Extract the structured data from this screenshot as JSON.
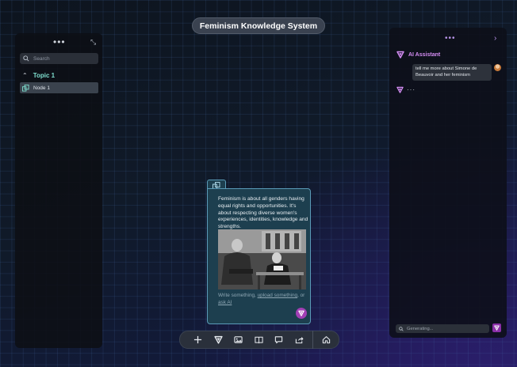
{
  "app": {
    "title": "Feminism Knowledge System"
  },
  "sidebar": {
    "menu_icon": "more-horizontal-icon",
    "collapse_icon": "collapse-arrow-icon",
    "search": {
      "placeholder": "Search",
      "value": ""
    },
    "topics": [
      {
        "label": "Topic 1",
        "expanded": true,
        "nodes": [
          {
            "label": "Node 1",
            "selected": true
          }
        ]
      }
    ]
  },
  "assistant": {
    "title": "AI Assistant",
    "menu_icon": "more-horizontal-icon",
    "close_icon": "chevron-right-icon",
    "messages": [
      {
        "role": "user",
        "text": "tell me more about Simone de Beauvoir and her feminism"
      },
      {
        "role": "assistant",
        "text": "···"
      }
    ],
    "input": {
      "placeholder": "Generating...",
      "value": ""
    }
  },
  "card": {
    "text": "Feminism is about all genders having equal rights and opportunities. It's about respecting diverse women's experiences, identities, knowledge and strengths.",
    "image_alt_icon": "photo-icon",
    "hint": {
      "prefix": "Write something, ",
      "upload_link": "upload something",
      "middle": ", or ",
      "ask_link": "ask AI"
    }
  },
  "toolbar": {
    "buttons": [
      {
        "name": "add-button",
        "icon": "plus-icon"
      },
      {
        "name": "ai-button",
        "icon": "ai-logo-icon"
      },
      {
        "name": "image-button",
        "icon": "image-icon"
      },
      {
        "name": "book-button",
        "icon": "book-icon"
      },
      {
        "name": "comment-button",
        "icon": "comment-icon"
      },
      {
        "name": "share-button",
        "icon": "share-icon"
      },
      {
        "name": "home-button",
        "icon": "home-icon"
      }
    ]
  },
  "colors": {
    "accent_teal": "#7fe0d0",
    "accent_purple": "#d68ef5",
    "ai_button": "#a23fb5",
    "card_bg": "#1d3f4f",
    "card_border": "#5a9bb8"
  }
}
